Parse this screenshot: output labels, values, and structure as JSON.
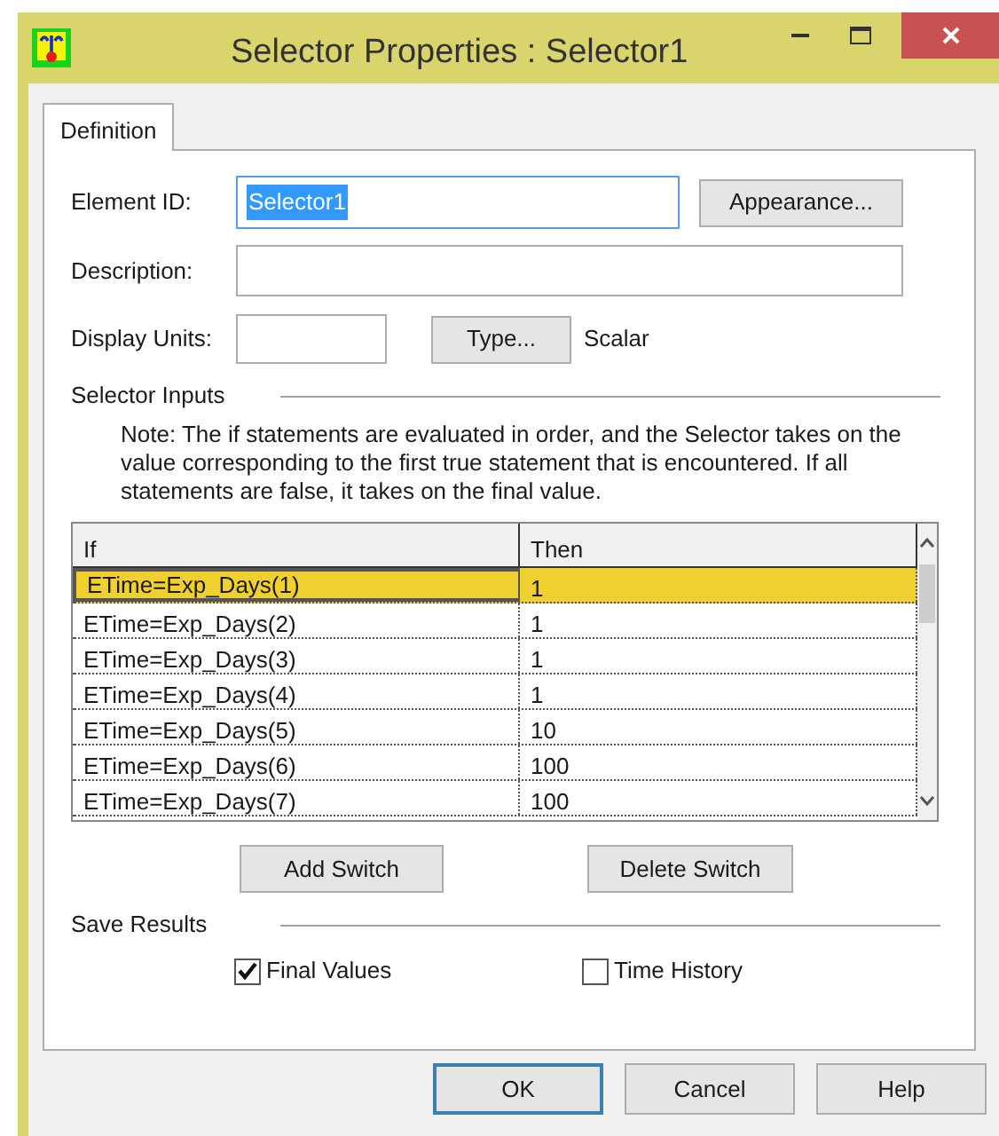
{
  "window": {
    "title": "Selector Properties : Selector1"
  },
  "tabs": [
    {
      "label": "Definition",
      "selected": true
    }
  ],
  "element_id": {
    "label": "Element ID:",
    "value": "Selector1",
    "highlighted": true
  },
  "appearance_button": "Appearance...",
  "description": {
    "label": "Description:"
  },
  "display_units": {
    "label": "Display Units:"
  },
  "type_button": "Type...",
  "type_value": "Scalar",
  "selector_inputs": {
    "heading": "Selector Inputs",
    "note": "Note: The if statements are evaluated in order, and the Selector takes on the value corresponding to the first true statement that is encountered. If all statements are false, it takes on the final value.",
    "columns": [
      "If",
      "Then"
    ],
    "rows": [
      {
        "if": "ETime=Exp_Days(1)",
        "then": "1",
        "selected": true
      },
      {
        "if": "ETime=Exp_Days(2)",
        "then": "1",
        "selected": false
      },
      {
        "if": "ETime=Exp_Days(3)",
        "then": "1",
        "selected": false
      },
      {
        "if": "ETime=Exp_Days(4)",
        "then": "1",
        "selected": false
      },
      {
        "if": "ETime=Exp_Days(5)",
        "then": "10",
        "selected": false
      },
      {
        "if": "ETime=Exp_Days(6)",
        "then": "100",
        "selected": false
      },
      {
        "if": "ETime=Exp_Days(7)",
        "then": "100",
        "selected": false
      }
    ],
    "buttons": [
      "Add Switch",
      "Delete Switch"
    ]
  },
  "save_results": {
    "heading": "Save Results",
    "options": [
      {
        "label": "Final Values",
        "checked": true
      },
      {
        "label": "Time History",
        "checked": false
      }
    ]
  },
  "footer_buttons": [
    {
      "label": "OK",
      "default": true
    },
    {
      "label": "Cancel",
      "default": false
    },
    {
      "label": "Help",
      "default": false
    }
  ]
}
